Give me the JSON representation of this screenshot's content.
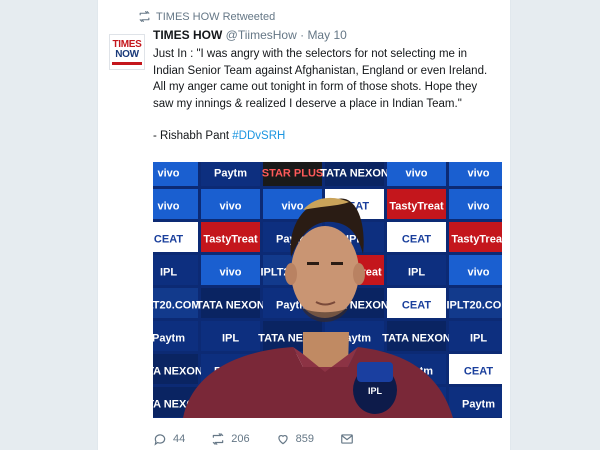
{
  "retweet": {
    "label": "TIMES HOW Retweeted"
  },
  "avatar": {
    "line1": "TIMES",
    "line2": "NOW"
  },
  "tweet": {
    "author_name": "TIMES HOW",
    "handle": "@TiimesHow",
    "separator": "·",
    "date": "May 10",
    "text": "Just In : \"I was angry with the selectors for not selecting me in Indian Senior Team against Afghanistan, England or even Ireland. All my anger came out tonight in form of those shots. Hope they saw my innings & realized I deserve a place in Indian Team.\"",
    "signature": "- Rishabh Pant",
    "hashtag": "#DDvSRH"
  },
  "media": {
    "brands": [
      "vivo",
      "CEAT",
      "TastyTreat",
      "IPL",
      "Paytm",
      "TATA NEXON",
      "IPLT20.COM",
      "STAR PLUS"
    ]
  },
  "actions": {
    "replies": "44",
    "retweets": "206",
    "likes": "859"
  },
  "colors": {
    "accent": "#1b95e0",
    "muted": "#657786",
    "board_blue": "#0d2f7f",
    "vivo_blue": "#1a5fd0",
    "ceat_red": "#c4161c"
  }
}
